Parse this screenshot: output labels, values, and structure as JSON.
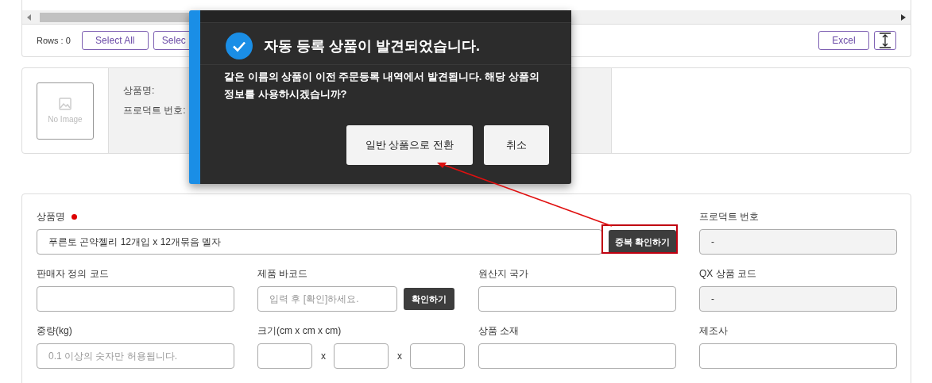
{
  "grid": {
    "rows_label": "Rows : 0",
    "buttons": [
      "Select All",
      "Selec"
    ],
    "excel": "Excel"
  },
  "preview": {
    "no_image": "No Image",
    "labels": [
      "상품명:",
      "프로덕트 번호:"
    ]
  },
  "form": {
    "name_label": "상품명",
    "required": true,
    "name_value": "푸른토 곤약젤리 12개입 x 12개묶음 멜자",
    "dup_button": "중복 확인하기",
    "fields": [
      {
        "kind": "readonly",
        "label": "프로덕트 번호",
        "value": "-"
      },
      {
        "kind": "text",
        "label": "판매자 정의 코드"
      },
      {
        "kind": "barcode",
        "label": "제품 바코드",
        "placeholder": "입력 후 [확인]하세요.",
        "button": "확인하기"
      },
      {
        "kind": "text",
        "label": "원산지 국가"
      },
      {
        "kind": "readonly",
        "label": "QX 상품 코드",
        "value": "-"
      },
      {
        "kind": "text",
        "label": "중량(kg)",
        "placeholder": "0.1 이상의 숫자만 허용됩니다."
      },
      {
        "kind": "size",
        "label": "크기(cm x cm x cm)",
        "separators": [
          "x",
          "x"
        ]
      },
      {
        "kind": "text",
        "label": "상품 소재"
      },
      {
        "kind": "text",
        "label": "제조사"
      }
    ]
  },
  "dialog": {
    "title": "자동 등록 상품이 발견되었습니다.",
    "message": "같은 이름의 상품이 이전 주문등록 내역에서 발견됩니다. 해당 상품의 정보를 사용하시겠습니까?",
    "buttons": [
      "일반 상품으로 전환",
      "취소"
    ]
  }
}
